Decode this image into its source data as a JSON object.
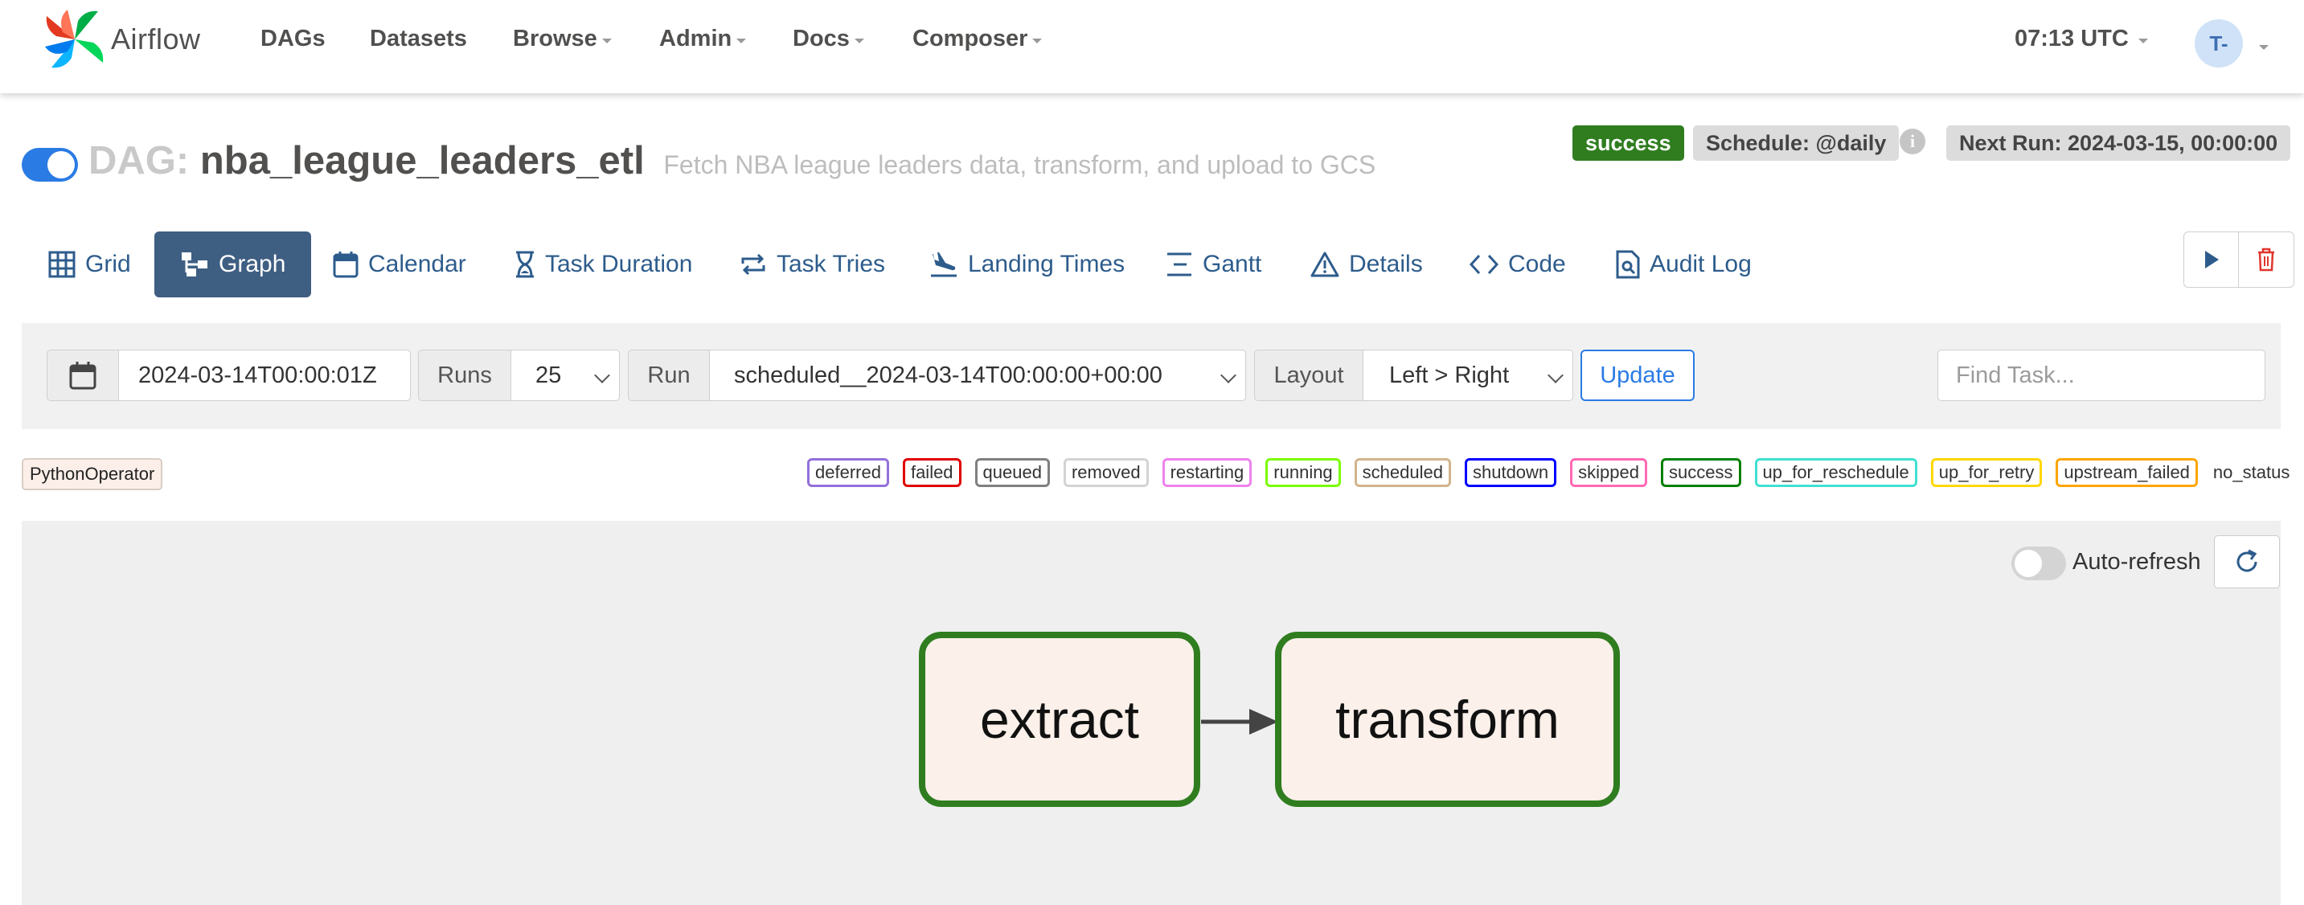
{
  "app": {
    "brand": "Airflow"
  },
  "nav": {
    "items": [
      {
        "label": "DAGs",
        "dropdown": false
      },
      {
        "label": "Datasets",
        "dropdown": false
      },
      {
        "label": "Browse",
        "dropdown": true
      },
      {
        "label": "Admin",
        "dropdown": true
      },
      {
        "label": "Docs",
        "dropdown": true
      },
      {
        "label": "Composer",
        "dropdown": true
      }
    ],
    "time": "07:13 UTC",
    "user_initials": "T-"
  },
  "dag": {
    "paused": false,
    "prefix": "DAG:",
    "id": "nba_league_leaders_etl",
    "description": "Fetch NBA league leaders data, transform, and upload to GCS",
    "status": "success",
    "schedule": "Schedule: @daily",
    "next_run": "Next Run: 2024-03-15, 00:00:00"
  },
  "tabs": [
    {
      "label": "Grid",
      "icon": "grid-icon",
      "active": false
    },
    {
      "label": "Graph",
      "icon": "graph-icon",
      "active": true
    },
    {
      "label": "Calendar",
      "icon": "calendar-icon",
      "active": false
    },
    {
      "label": "Task Duration",
      "icon": "hourglass-icon",
      "active": false
    },
    {
      "label": "Task Tries",
      "icon": "retry-icon",
      "active": false
    },
    {
      "label": "Landing Times",
      "icon": "landing-icon",
      "active": false
    },
    {
      "label": "Gantt",
      "icon": "gantt-icon",
      "active": false
    },
    {
      "label": "Details",
      "icon": "warning-triangle-icon",
      "active": false
    },
    {
      "label": "Code",
      "icon": "code-icon",
      "active": false
    },
    {
      "label": "Audit Log",
      "icon": "file-search-icon",
      "active": false
    }
  ],
  "controls": {
    "base_date": "2024-03-14T00:00:01Z",
    "runs_label": "Runs",
    "runs_value": "25",
    "run_label": "Run",
    "run_value": "scheduled__2024-03-14T00:00:00+00:00",
    "layout_label": "Layout",
    "layout_value": "Left > Right",
    "update_label": "Update",
    "find_placeholder": "Find Task..."
  },
  "legend": {
    "operator": "PythonOperator",
    "states": [
      {
        "label": "deferred",
        "color": "#9370db"
      },
      {
        "label": "failed",
        "color": "#e00000"
      },
      {
        "label": "queued",
        "color": "#808080"
      },
      {
        "label": "removed",
        "color": "#d3d3d3"
      },
      {
        "label": "restarting",
        "color": "#ee82ee"
      },
      {
        "label": "running",
        "color": "#7cfc00"
      },
      {
        "label": "scheduled",
        "color": "#d2b48c"
      },
      {
        "label": "shutdown",
        "color": "#0000ff"
      },
      {
        "label": "skipped",
        "color": "#ff69b4"
      },
      {
        "label": "success",
        "color": "#008000"
      },
      {
        "label": "up_for_reschedule",
        "color": "#40e0d0"
      },
      {
        "label": "up_for_retry",
        "color": "#ffd700"
      },
      {
        "label": "upstream_failed",
        "color": "#ffa500"
      }
    ],
    "no_status": "no_status"
  },
  "graph": {
    "auto_refresh_label": "Auto-refresh",
    "auto_refresh": false,
    "nodes": [
      {
        "label": "extract",
        "state": "success"
      },
      {
        "label": "transform",
        "state": "success"
      }
    ],
    "edges": [
      {
        "from": "extract",
        "to": "transform"
      }
    ]
  }
}
